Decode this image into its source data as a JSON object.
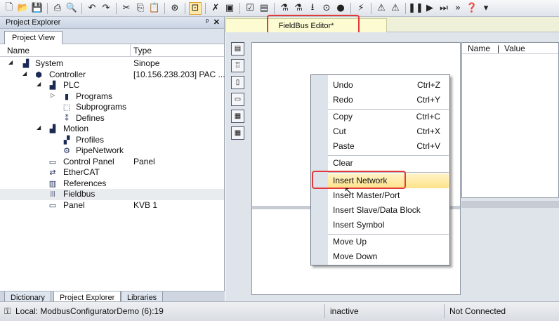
{
  "toolbar": {
    "icons": [
      "new-file",
      "open-folder",
      "save",
      "print",
      "print-preview",
      "undo",
      "redo",
      "cut",
      "copy",
      "paste",
      "find",
      "properties",
      "tools",
      "window",
      "check",
      "compile",
      "download",
      "run",
      "stop",
      "pause",
      "next",
      "step",
      "more",
      "help"
    ]
  },
  "left_panel": {
    "title": "Project Explorer",
    "pin_glyph": "ᵖ",
    "close_glyph": "✕",
    "tab": "Project View",
    "columns": {
      "name": "Name",
      "type": "Type"
    },
    "tree": [
      {
        "label": "System",
        "type": "Sinope"
      },
      {
        "label": "Controller",
        "type": "[10.156.238.203] PAC ..."
      },
      {
        "label": "PLC",
        "type": ""
      },
      {
        "label": "Programs",
        "type": ""
      },
      {
        "label": "Subprograms",
        "type": ""
      },
      {
        "label": "Defines",
        "type": ""
      },
      {
        "label": "Motion",
        "type": ""
      },
      {
        "label": "Profiles",
        "type": ""
      },
      {
        "label": "PipeNetwork",
        "type": ""
      },
      {
        "label": "Control Panel",
        "type": "Panel"
      },
      {
        "label": "EtherCAT",
        "type": ""
      },
      {
        "label": "References",
        "type": ""
      },
      {
        "label": "Fieldbus",
        "type": ""
      },
      {
        "label": "Panel",
        "type": "KVB 1"
      }
    ],
    "bottom_tabs": [
      "Dictionary",
      "Project Explorer",
      "Libraries"
    ]
  },
  "editor": {
    "tab_title": "FieldBus Editor*",
    "props_header": {
      "name": "Name",
      "sep": "|",
      "value": "Value"
    }
  },
  "context_menu": {
    "items": [
      {
        "label": "Undo",
        "shortcut": "Ctrl+Z"
      },
      {
        "label": "Redo",
        "shortcut": "Ctrl+Y"
      },
      {
        "label": "Copy",
        "shortcut": "Ctrl+C"
      },
      {
        "label": "Cut",
        "shortcut": "Ctrl+X"
      },
      {
        "label": "Paste",
        "shortcut": "Ctrl+V"
      },
      {
        "label": "Clear",
        "shortcut": ""
      },
      {
        "label": "Insert Network",
        "shortcut": ""
      },
      {
        "label": "Insert Master/Port",
        "shortcut": ""
      },
      {
        "label": "Insert Slave/Data Block",
        "shortcut": ""
      },
      {
        "label": "Insert Symbol",
        "shortcut": ""
      },
      {
        "label": "Move Up",
        "shortcut": ""
      },
      {
        "label": "Move Down",
        "shortcut": ""
      }
    ]
  },
  "status": {
    "connection": "Local: ModbusConfiguratorDemo (6):19",
    "state": "inactive",
    "link": "Not Connected"
  },
  "colors": {
    "highlight_box": "#e23a3a",
    "menu_highlight": "#ffe38a"
  }
}
